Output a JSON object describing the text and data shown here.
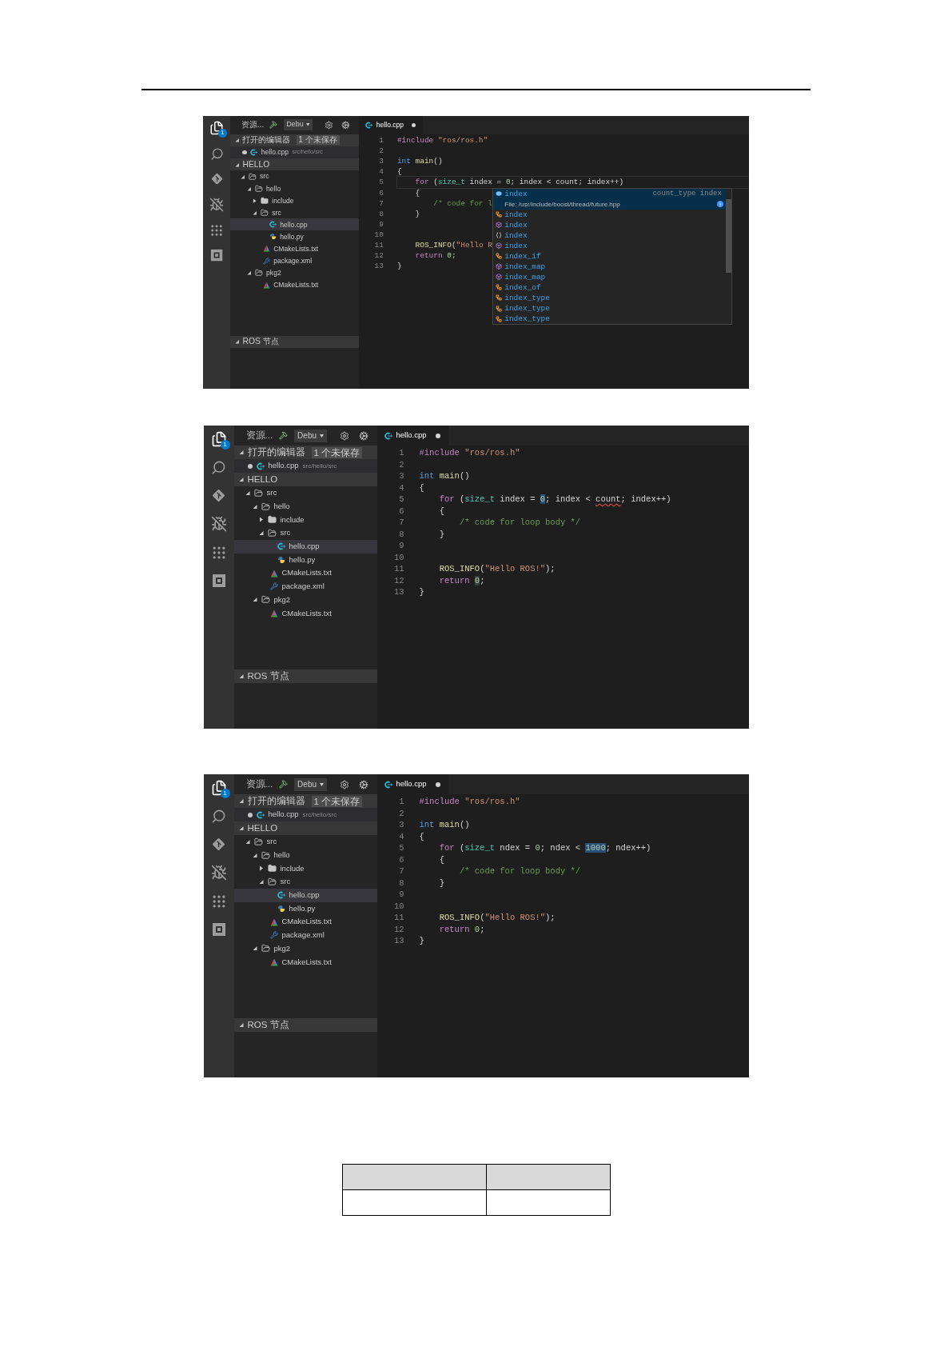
{
  "screens": [
    {
      "activity_bar": [
        {
          "kind": "files",
          "selected": true,
          "badge": "1"
        },
        {
          "kind": "search",
          "selected": false
        },
        {
          "kind": "git",
          "selected": false
        },
        {
          "kind": "debug",
          "selected": false
        },
        {
          "kind": "extensions",
          "selected": false
        },
        {
          "kind": "remote",
          "selected": false
        }
      ],
      "toolbar": {
        "title": "资源...",
        "config": "Debu"
      },
      "open_editors": {
        "title": "打开的编辑器",
        "badge": "1 个未保存",
        "expanded": true,
        "items": [
          {
            "dirty": true,
            "kind": "cpp",
            "name": "hello.cpp",
            "path": "src/hello/src"
          }
        ]
      },
      "folder": {
        "title": "HELLO",
        "expanded": true,
        "tree": [
          {
            "name": "src",
            "kind": "folder",
            "expanded": true,
            "children": [
              {
                "name": "hello",
                "kind": "folder",
                "expanded": true,
                "children": [
                  {
                    "name": "include",
                    "kind": "folder",
                    "expanded": false
                  },
                  {
                    "name": "src",
                    "kind": "folder",
                    "expanded": true,
                    "children": [
                      {
                        "name": "hello.cpp",
                        "kind": "cpp",
                        "selected": true
                      },
                      {
                        "name": "hello.py",
                        "kind": "python",
                        "selected": false
                      }
                    ]
                  },
                  {
                    "name": "CMakeLists.txt",
                    "kind": "cmake",
                    "selected": false
                  },
                  {
                    "name": "package.xml",
                    "kind": "xml",
                    "selected": false
                  }
                ]
              },
              {
                "name": "pkg2",
                "kind": "folder",
                "expanded": true,
                "children": [
                  {
                    "name": "CMakeLists.txt",
                    "kind": "cmake",
                    "selected": false
                  }
                ]
              }
            ]
          }
        ]
      },
      "ros_section": {
        "title": "ROS 节点",
        "expanded": true
      },
      "tab": {
        "name": "hello.cpp",
        "kind": "cpp",
        "dirty": true
      },
      "editor": {
        "lines": [
          {
            "number": "1",
            "current": false,
            "tokens": [
              {
                "text": "#include",
                "kind": "keyword"
              },
              {
                "text": " \"ros/ros.h\"",
                "kind": "string"
              }
            ]
          },
          {
            "number": "2",
            "current": false
          },
          {
            "number": "3",
            "current": false,
            "tokens": [
              {
                "text": "int",
                "kind": "type"
              },
              {
                "text": " main",
                "kind": "func"
              },
              {
                "text": "()",
                "kind": "plain"
              }
            ]
          },
          {
            "number": "4",
            "current": false,
            "tokens": [
              {
                "text": "{",
                "kind": "plain"
              }
            ]
          },
          {
            "number": "5",
            "current": true,
            "tokens": [
              {
                "text": "    for",
                "kind": "keyword"
              },
              {
                "text": " (",
                "kind": "plain"
              },
              {
                "text": "size_t",
                "kind": "typename"
              },
              {
                "text": " index = ",
                "kind": "plain"
              },
              {
                "text": "0",
                "kind": "number"
              },
              {
                "text": "; index < count; index++)",
                "kind": "plain"
              }
            ]
          },
          {
            "number": "6",
            "current": false,
            "tokens": [
              {
                "text": "    {",
                "kind": "plain"
              }
            ]
          },
          {
            "number": "7",
            "current": false,
            "tokens": [
              {
                "text": "        /* code for l",
                "kind": "comment"
              }
            ]
          },
          {
            "number": "8",
            "current": false,
            "tokens": [
              {
                "text": "    }",
                "kind": "plain"
              }
            ]
          },
          {
            "number": "9",
            "current": false
          },
          {
            "number": "10",
            "current": false
          },
          {
            "number": "11",
            "current": false,
            "tokens": [
              {
                "text": "    ROS_INFO",
                "kind": "func"
              },
              {
                "text": "(",
                "kind": "plain"
              },
              {
                "text": "\"Hello R",
                "kind": "string"
              }
            ]
          },
          {
            "number": "12",
            "current": false,
            "tokens": [
              {
                "text": "    return",
                "kind": "keyword"
              },
              {
                "text": " 0",
                "kind": "number"
              },
              {
                "text": ";",
                "kind": "plain"
              }
            ]
          },
          {
            "number": "13",
            "current": false,
            "tokens": [
              {
                "text": "}",
                "kind": "plain"
              }
            ]
          }
        ],
        "suggest": {
          "items": [
            {
              "label": "index",
              "kind": "variable",
              "selected": true,
              "detail": "count_type index",
              "file": "File: /usr/include/boost/thread/future.hpp"
            },
            {
              "label": "index",
              "kind": "class",
              "selected": false
            },
            {
              "label": "index",
              "kind": "module",
              "selected": false
            },
            {
              "label": "index",
              "kind": "function",
              "selected": false
            },
            {
              "label": "index",
              "kind": "module",
              "selected": false
            },
            {
              "label": "index_if",
              "kind": "class",
              "selected": false
            },
            {
              "label": "index_map",
              "kind": "module",
              "selected": false
            },
            {
              "label": "index_map",
              "kind": "module",
              "selected": false
            },
            {
              "label": "index_of",
              "kind": "class",
              "selected": false
            },
            {
              "label": "index_type",
              "kind": "class",
              "selected": false
            },
            {
              "label": "index_type",
              "kind": "class",
              "selected": false
            },
            {
              "label": "index_type",
              "kind": "class",
              "selected": false
            }
          ]
        }
      }
    },
    {
      "activity_bar": [
        {
          "kind": "files",
          "selected": true,
          "badge": "1"
        },
        {
          "kind": "search",
          "selected": false
        },
        {
          "kind": "git",
          "selected": false
        },
        {
          "kind": "debug",
          "selected": false
        },
        {
          "kind": "extensions",
          "selected": false
        },
        {
          "kind": "remote",
          "selected": false
        }
      ],
      "toolbar": {
        "title": "资源...",
        "config": "Debu"
      },
      "open_editors": {
        "title": "打开的编辑器",
        "badge": "1 个未保存",
        "expanded": true,
        "items": [
          {
            "dirty": true,
            "kind": "cpp",
            "name": "hello.cpp",
            "path": "src/hello/src"
          }
        ]
      },
      "folder": {
        "title": "HELLO",
        "expanded": true,
        "tree": [
          {
            "name": "src",
            "kind": "folder",
            "expanded": true,
            "children": [
              {
                "name": "hello",
                "kind": "folder",
                "expanded": true,
                "children": [
                  {
                    "name": "include",
                    "kind": "folder",
                    "expanded": false
                  },
                  {
                    "name": "src",
                    "kind": "folder",
                    "expanded": true,
                    "children": [
                      {
                        "name": "hello.cpp",
                        "kind": "cpp",
                        "selected": true
                      },
                      {
                        "name": "hello.py",
                        "kind": "python",
                        "selected": false
                      }
                    ]
                  },
                  {
                    "name": "CMakeLists.txt",
                    "kind": "cmake",
                    "selected": false
                  },
                  {
                    "name": "package.xml",
                    "kind": "xml",
                    "selected": false
                  }
                ]
              },
              {
                "name": "pkg2",
                "kind": "folder",
                "expanded": true,
                "children": [
                  {
                    "name": "CMakeLists.txt",
                    "kind": "cmake",
                    "selected": false
                  }
                ]
              }
            ]
          }
        ]
      },
      "ros_section": {
        "title": "ROS 节点",
        "expanded": true
      },
      "tab": {
        "name": "hello.cpp",
        "kind": "cpp",
        "dirty": true
      },
      "editor": {
        "lines": [
          {
            "number": "1",
            "tokens": [
              {
                "text": "#include",
                "kind": "keyword"
              },
              {
                "text": " \"ros/ros.h\"",
                "kind": "string"
              }
            ]
          },
          {
            "number": "2"
          },
          {
            "number": "3",
            "tokens": [
              {
                "text": "int",
                "kind": "type"
              },
              {
                "text": " main",
                "kind": "func"
              },
              {
                "text": "()",
                "kind": "plain"
              }
            ]
          },
          {
            "number": "4",
            "tokens": [
              {
                "text": "{",
                "kind": "plain"
              }
            ]
          },
          {
            "number": "5",
            "tokens": [
              {
                "text": "    for",
                "kind": "keyword"
              },
              {
                "text": " (",
                "kind": "plain"
              },
              {
                "text": "size_t",
                "kind": "typename"
              },
              {
                "text": " index = ",
                "kind": "plain"
              },
              {
                "text": "0",
                "kind": "number",
                "selected": true
              },
              {
                "text": "; index < ",
                "kind": "plain"
              },
              {
                "text": "count",
                "kind": "plain",
                "error": true
              },
              {
                "text": "; index++)",
                "kind": "plain"
              }
            ]
          },
          {
            "number": "6",
            "tokens": [
              {
                "text": "    {",
                "kind": "plain"
              }
            ]
          },
          {
            "number": "7",
            "tokens": [
              {
                "text": "        /* code for loop body */",
                "kind": "comment"
              }
            ]
          },
          {
            "number": "8",
            "tokens": [
              {
                "text": "    }",
                "kind": "plain"
              }
            ]
          },
          {
            "number": "9"
          },
          {
            "number": "10"
          },
          {
            "number": "11",
            "tokens": [
              {
                "text": "    ROS_INFO",
                "kind": "func"
              },
              {
                "text": "(",
                "kind": "plain"
              },
              {
                "text": "\"Hello ROS!\"",
                "kind": "string"
              },
              {
                "text": ");",
                "kind": "plain"
              }
            ]
          },
          {
            "number": "12",
            "tokens": [
              {
                "text": "    return ",
                "kind": "keyword"
              },
              {
                "text": "0",
                "kind": "number",
                "highlighted": true
              },
              {
                "text": ";",
                "kind": "plain"
              }
            ]
          },
          {
            "number": "13",
            "tokens": [
              {
                "text": "}",
                "kind": "plain"
              }
            ]
          }
        ]
      }
    },
    {
      "activity_bar": [
        {
          "kind": "files",
          "selected": true,
          "badge": "1"
        },
        {
          "kind": "search",
          "selected": false
        },
        {
          "kind": "git",
          "selected": false
        },
        {
          "kind": "debug",
          "selected": false
        },
        {
          "kind": "extensions",
          "selected": false
        },
        {
          "kind": "remote",
          "selected": false
        }
      ],
      "toolbar": {
        "title": "资源...",
        "config": "Debu"
      },
      "open_editors": {
        "title": "打开的编辑器",
        "badge": "1 个未保存",
        "expanded": true,
        "items": [
          {
            "dirty": true,
            "kind": "cpp",
            "name": "hello.cpp",
            "path": "src/hello/src"
          }
        ]
      },
      "folder": {
        "title": "HELLO",
        "expanded": true,
        "tree": [
          {
            "name": "src",
            "kind": "folder",
            "expanded": true,
            "children": [
              {
                "name": "hello",
                "kind": "folder",
                "expanded": true,
                "children": [
                  {
                    "name": "include",
                    "kind": "folder",
                    "expanded": false
                  },
                  {
                    "name": "src",
                    "kind": "folder",
                    "expanded": true,
                    "children": [
                      {
                        "name": "hello.cpp",
                        "kind": "cpp",
                        "selected": true
                      },
                      {
                        "name": "hello.py",
                        "kind": "python",
                        "selected": false
                      }
                    ]
                  },
                  {
                    "name": "CMakeLists.txt",
                    "kind": "cmake",
                    "selected": false
                  },
                  {
                    "name": "package.xml",
                    "kind": "xml",
                    "selected": false
                  }
                ]
              },
              {
                "name": "pkg2",
                "kind": "folder",
                "expanded": true,
                "children": [
                  {
                    "name": "CMakeLists.txt",
                    "kind": "cmake",
                    "selected": false
                  }
                ]
              }
            ]
          }
        ]
      },
      "ros_section": {
        "title": "ROS 节点",
        "expanded": true
      },
      "tab": {
        "name": "hello.cpp",
        "kind": "cpp",
        "dirty": true
      },
      "editor": {
        "lines": [
          {
            "number": "1",
            "tokens": [
              {
                "text": "#include",
                "kind": "keyword"
              },
              {
                "text": " \"ros/ros.h\"",
                "kind": "string"
              }
            ]
          },
          {
            "number": "2"
          },
          {
            "number": "3",
            "tokens": [
              {
                "text": "int",
                "kind": "type"
              },
              {
                "text": " main",
                "kind": "func"
              },
              {
                "text": "()",
                "kind": "plain"
              }
            ]
          },
          {
            "number": "4",
            "tokens": [
              {
                "text": "{",
                "kind": "plain"
              }
            ]
          },
          {
            "number": "5",
            "tokens": [
              {
                "text": "    for",
                "kind": "keyword"
              },
              {
                "text": " (",
                "kind": "plain"
              },
              {
                "text": "size_t",
                "kind": "typename"
              },
              {
                "text": " ndex = ",
                "kind": "plain"
              },
              {
                "text": "0",
                "kind": "number"
              },
              {
                "text": "; ndex < ",
                "kind": "plain"
              },
              {
                "text": "1000",
                "kind": "number",
                "selected": true
              },
              {
                "text": "; ndex++)",
                "kind": "plain"
              }
            ]
          },
          {
            "number": "6",
            "tokens": [
              {
                "text": "    {",
                "kind": "plain"
              }
            ]
          },
          {
            "number": "7",
            "tokens": [
              {
                "text": "        /* code for loop body */",
                "kind": "comment"
              }
            ]
          },
          {
            "number": "8",
            "tokens": [
              {
                "text": "    }",
                "kind": "plain"
              }
            ]
          },
          {
            "number": "9"
          },
          {
            "number": "10"
          },
          {
            "number": "11",
            "tokens": [
              {
                "text": "    ROS_INFO",
                "kind": "func"
              },
              {
                "text": "(",
                "kind": "plain"
              },
              {
                "text": "\"Hello ROS!\"",
                "kind": "string"
              },
              {
                "text": ");",
                "kind": "plain"
              }
            ]
          },
          {
            "number": "12",
            "tokens": [
              {
                "text": "    return",
                "kind": "keyword"
              },
              {
                "text": " 0",
                "kind": "number"
              },
              {
                "text": ";",
                "kind": "plain"
              }
            ]
          },
          {
            "number": "13",
            "tokens": [
              {
                "text": "}",
                "kind": "plain"
              }
            ]
          }
        ]
      }
    }
  ],
  "table": {
    "rows": [
      {
        "header": true,
        "cells": [
          {
            "kind": "blank"
          },
          {
            "kind": "blank"
          }
        ]
      },
      {
        "header": false,
        "cells": [
          {
            "kind": "blank"
          },
          {
            "kind": "blank"
          }
        ]
      }
    ]
  }
}
